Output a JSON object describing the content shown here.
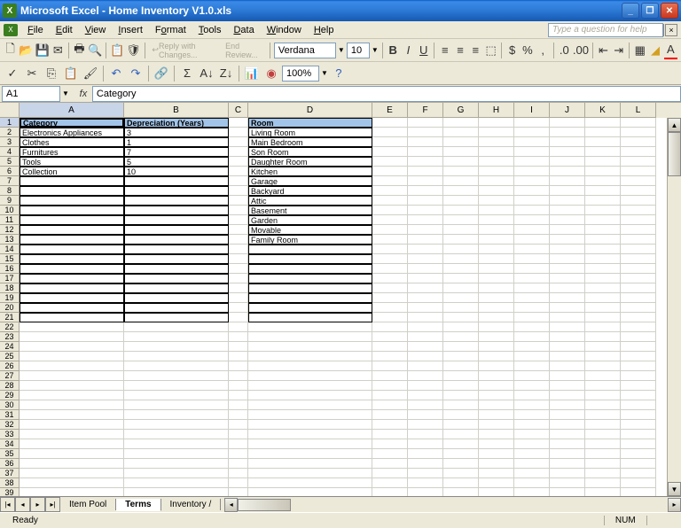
{
  "titlebar": {
    "app": "Microsoft Excel",
    "doc": "Home Inventory V1.0.xls"
  },
  "menu": {
    "file": "File",
    "edit": "Edit",
    "view": "View",
    "insert": "Insert",
    "format": "Format",
    "tools": "Tools",
    "data": "Data",
    "window": "Window",
    "help": "Help",
    "helpbox": "Type a question for help"
  },
  "toolbar": {
    "reply": "Reply with Changes...",
    "review": "End Review...",
    "font": "Verdana",
    "size": "10",
    "zoom": "100%"
  },
  "formula": {
    "namebox": "A1",
    "fx": "fx",
    "value": "Category"
  },
  "headers": {
    "colA": "Category",
    "colB": "Depreciation (Years)",
    "colD": "Room"
  },
  "categories": [
    {
      "name": "Electronics Appliances",
      "dep": "3"
    },
    {
      "name": "Clothes",
      "dep": "1"
    },
    {
      "name": "Furnitures",
      "dep": "7"
    },
    {
      "name": "Tools",
      "dep": "5"
    },
    {
      "name": "Collection",
      "dep": "10"
    }
  ],
  "rooms": [
    "Living Room",
    "Main Bedroom",
    "Son Room",
    "Daughter Room",
    "Kitchen",
    "Garage",
    "Backyard",
    "Attic",
    "Basement",
    "Garden",
    "Movable",
    "Family Room"
  ],
  "tabs": {
    "t1": "Item Pool",
    "t2": "Terms",
    "t3": "Inventory"
  },
  "status": {
    "ready": "Ready",
    "num": "NUM"
  },
  "cols": [
    "A",
    "B",
    "C",
    "D",
    "E",
    "F",
    "G",
    "H",
    "I",
    "J",
    "K",
    "L"
  ]
}
